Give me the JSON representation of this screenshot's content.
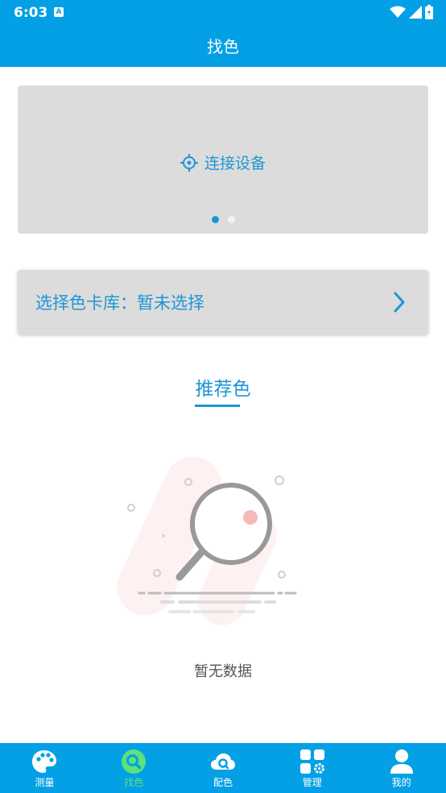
{
  "status": {
    "time": "6:03",
    "notif_letter": "A"
  },
  "header": {
    "title": "找色"
  },
  "banner": {
    "connect_label": "连接设备"
  },
  "selector": {
    "label": "选择色卡库：暂未选择"
  },
  "recommend": {
    "title": "推荐色"
  },
  "empty": {
    "text": "暂无数据"
  },
  "nav": {
    "items": [
      {
        "label": "测量",
        "icon": "palette-icon"
      },
      {
        "label": "找色",
        "icon": "search-icon"
      },
      {
        "label": "配色",
        "icon": "cloud-icon"
      },
      {
        "label": "管理",
        "icon": "grid-gear-icon"
      },
      {
        "label": "我的",
        "icon": "person-icon"
      }
    ]
  },
  "colors": {
    "primary": "#04A0E6",
    "accent_text": "#1D96D6",
    "active_nav": "#5EE07A",
    "card_bg": "#DCDCDC"
  }
}
